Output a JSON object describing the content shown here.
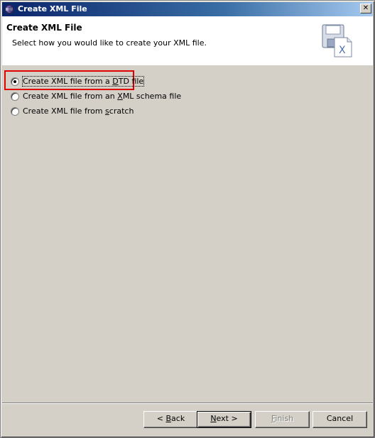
{
  "window": {
    "title": "Create XML File"
  },
  "banner": {
    "title": "Create XML File",
    "description": "Select how you would like to create your XML file."
  },
  "options": [
    {
      "pre": "Create XML file from a ",
      "mnemonic": "D",
      "post": "TD file",
      "selected": true
    },
    {
      "pre": "Create XML file from an ",
      "mnemonic": "X",
      "post": "ML schema file",
      "selected": false
    },
    {
      "pre": "Create XML file from ",
      "mnemonic": "s",
      "post": "cratch",
      "selected": false
    }
  ],
  "buttons": {
    "back": {
      "pre": "< ",
      "mnemonic": "B",
      "post": "ack"
    },
    "next": {
      "pre": "",
      "mnemonic": "N",
      "post": "ext >"
    },
    "finish": {
      "pre": "",
      "mnemonic": "F",
      "post": "inish"
    },
    "cancel": {
      "label": "Cancel"
    }
  },
  "colors": {
    "highlight": "#e00000",
    "titlebar": "#0a246a"
  },
  "icons": {
    "title": "eclipse-icon",
    "banner": "xml-file-wizard-icon",
    "close": "close-icon"
  }
}
